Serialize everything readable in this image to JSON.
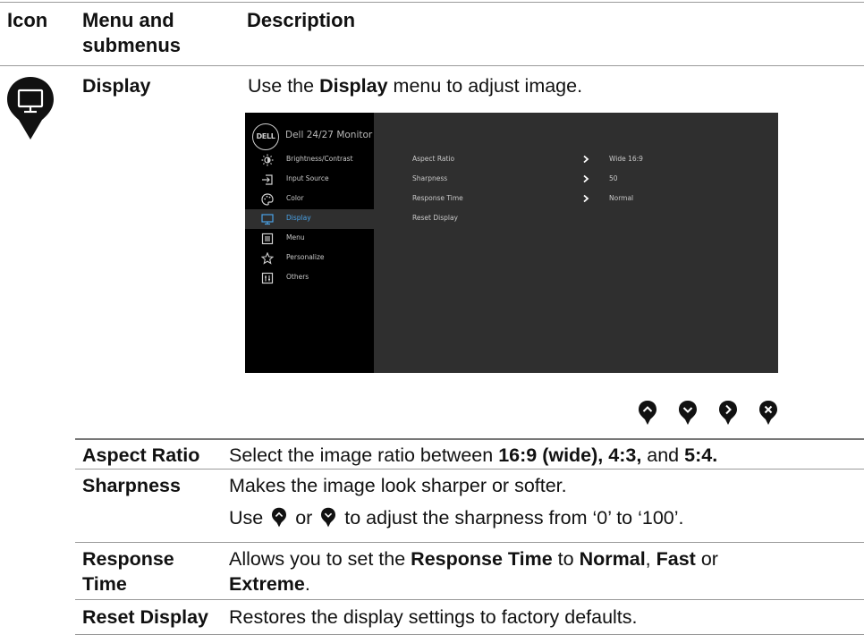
{
  "headers": {
    "icon": "Icon",
    "menu_line1": "Menu and",
    "menu_line2": "submenus",
    "description": "Description"
  },
  "display_section": {
    "icon": "monitor-pin-icon",
    "name": "Display",
    "desc_pre": "Use the ",
    "desc_bold": "Display",
    "desc_post": " menu to adjust image."
  },
  "osd": {
    "logo": "DELL",
    "title": "Dell 24/27 Monitor",
    "menu": [
      {
        "label": "Brightness/Contrast",
        "icon": "brightness-icon",
        "active": false
      },
      {
        "label": "Input Source",
        "icon": "input-source-icon",
        "active": false
      },
      {
        "label": "Color",
        "icon": "color-icon",
        "active": false
      },
      {
        "label": "Display",
        "icon": "display-icon",
        "active": true
      },
      {
        "label": "Menu",
        "icon": "menu-icon",
        "active": false
      },
      {
        "label": "Personalize",
        "icon": "star-icon",
        "active": false
      },
      {
        "label": "Others",
        "icon": "others-icon",
        "active": false
      }
    ],
    "settings": [
      {
        "name": "Aspect Ratio",
        "value": "Wide 16:9",
        "arrow": true
      },
      {
        "name": "Sharpness",
        "value": "50",
        "arrow": true
      },
      {
        "name": "Response Time",
        "value": "Normal",
        "arrow": true
      },
      {
        "name": "Reset Display",
        "value": "",
        "arrow": false
      }
    ],
    "colors": {
      "active_label": "#4aa3e8",
      "panel_bg": "#2f2f2f",
      "menu_bg": "#000000"
    }
  },
  "nav_buttons": [
    "up-button-icon",
    "down-button-icon",
    "right-button-icon",
    "exit-button-icon"
  ],
  "rows": {
    "aspect": {
      "name": "Aspect Ratio",
      "pre": "Select the image ratio between ",
      "b1": "16:9 (wide), 4:3,",
      "mid": " and ",
      "b2": "5:4."
    },
    "sharpness": {
      "name": "Sharpness",
      "line1": "Makes the image look sharper or softer.",
      "l2_pre": "Use ",
      "l2_or": " or ",
      "l2_post": " to adjust the sharpness from ‘0’ to ‘100’."
    },
    "response": {
      "name_line1": "Response",
      "name_line2": "Time",
      "pre": "Allows you to set the ",
      "b1": "Response Time",
      "t1": " to ",
      "b2": "Normal",
      "t2": ", ",
      "b3": "Fast",
      "t3": " or",
      "b4": "Extreme",
      "t4": "."
    },
    "reset": {
      "name": "Reset Display",
      "desc": "Restores the display settings to factory defaults."
    }
  }
}
